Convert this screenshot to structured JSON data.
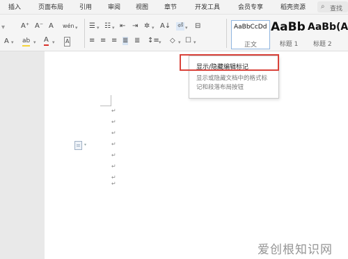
{
  "menu": {
    "items": [
      "插入",
      "页面布局",
      "引用",
      "审阅",
      "视图",
      "章节",
      "开发工具",
      "会员专享",
      "稻壳资源"
    ],
    "search_label": "查找"
  },
  "ribbon": {
    "font_grow": "A⁺",
    "font_shrink": "A⁻",
    "clear_format": "A",
    "phonetic": "wén",
    "text_effect": "A",
    "highlight": "ab",
    "font_color": "A",
    "char_border": "A",
    "styles": [
      {
        "sample": "AaBbCcDd",
        "label": "正文"
      },
      {
        "sample": "AaBb",
        "label": "标题 1"
      },
      {
        "sample": "AaBb(A",
        "label": "标题 2"
      }
    ]
  },
  "tooltip": {
    "title": "显示/隐藏编辑标记",
    "description": "显示或隐藏文档中的格式标记和段落布局按钮"
  },
  "document": {
    "paragraph_marks": [
      "↵",
      "↵",
      "↵",
      "↵",
      "↵",
      "↵",
      "↵",
      "↵"
    ]
  },
  "watermark": "爱创根知识网"
}
